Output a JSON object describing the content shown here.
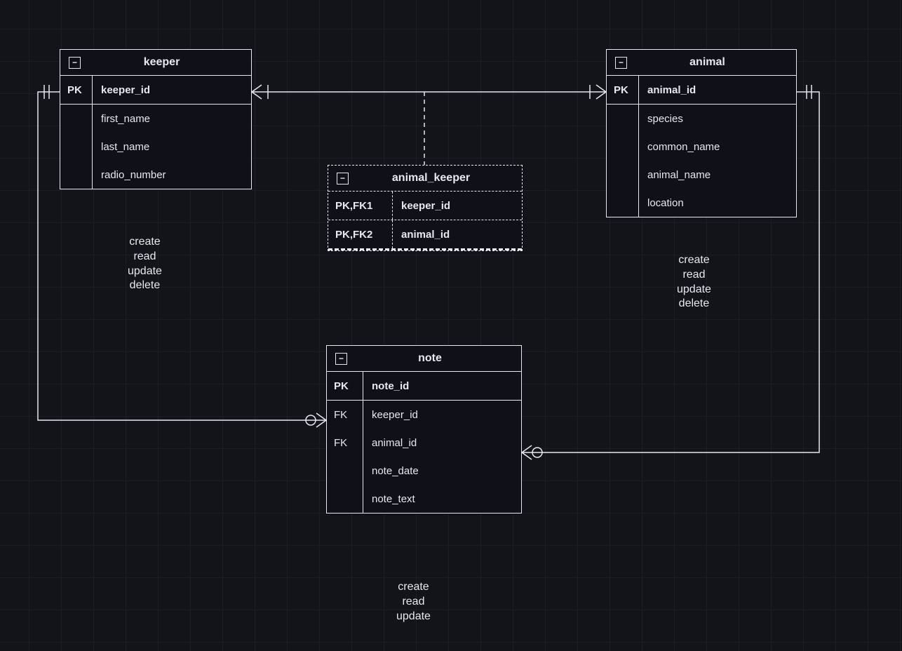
{
  "entities": {
    "keeper": {
      "title": "keeper",
      "pk_label": "PK",
      "pk_field": "keeper_id",
      "attrs": [
        "first_name",
        "last_name",
        "radio_number"
      ]
    },
    "animal": {
      "title": "animal",
      "pk_label": "PK",
      "pk_field": "animal_id",
      "attrs": [
        "species",
        "common_name",
        "animal_name",
        "location"
      ]
    },
    "animal_keeper": {
      "title": "animal_keeper",
      "rows": [
        {
          "key": "PK,FK1",
          "field": "keeper_id"
        },
        {
          "key": "PK,FK2",
          "field": "animal_id"
        }
      ]
    },
    "note": {
      "title": "note",
      "pk_label": "PK",
      "pk_field": "note_id",
      "rows": [
        {
          "key": "FK",
          "field": "keeper_id"
        },
        {
          "key": "FK",
          "field": "animal_id"
        },
        {
          "key": "",
          "field": "note_date"
        },
        {
          "key": "",
          "field": "note_text"
        }
      ]
    }
  },
  "crud": {
    "keeper": [
      "create",
      "read",
      "update",
      "delete"
    ],
    "animal": [
      "create",
      "read",
      "update",
      "delete"
    ],
    "note": [
      "create",
      "read",
      "update"
    ]
  },
  "collapse_glyph": "−"
}
